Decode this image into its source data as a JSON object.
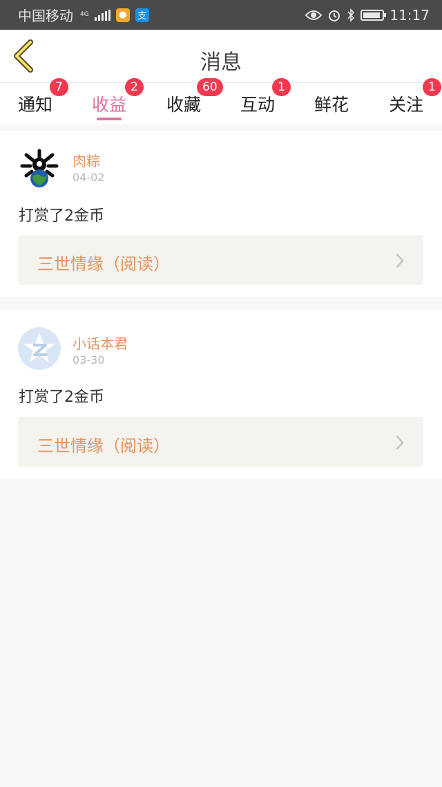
{
  "status_bar": {
    "carrier": "中国移动",
    "network": "4G",
    "time": "11:17",
    "icons": [
      "signal-bars-icon",
      "tmall-app-icon",
      "alipay-app-icon",
      "eye-icon",
      "alarm-icon",
      "bluetooth-icon",
      "battery-icon"
    ]
  },
  "header": {
    "title": "消息",
    "back_icon": "chevron-left-icon"
  },
  "tabs": [
    {
      "label": "通知",
      "badge": "7",
      "active": false
    },
    {
      "label": "收益",
      "badge": "2",
      "active": true
    },
    {
      "label": "收藏",
      "badge": "60",
      "active": false
    },
    {
      "label": "互动",
      "badge": "1",
      "active": false
    },
    {
      "label": "鲜花",
      "badge": "",
      "active": false
    },
    {
      "label": "关注",
      "badge": "1",
      "active": false
    }
  ],
  "messages": [
    {
      "username": "肉粽",
      "date": "04-02",
      "text": "打赏了2金币",
      "book": "三世情缘（阅读）",
      "avatar": "dark-ink-globe-avatar"
    },
    {
      "username": "小话本君",
      "date": "03-30",
      "text": "打赏了2金币",
      "book": "三世情缘（阅读）",
      "avatar": "default-qq-avatar"
    }
  ],
  "colors": {
    "accent": "#e071a0",
    "badge": "#f0394f",
    "username": "#e8935d",
    "book_bg": "#f4f3ee",
    "status_bar": "#4a4a4a"
  }
}
